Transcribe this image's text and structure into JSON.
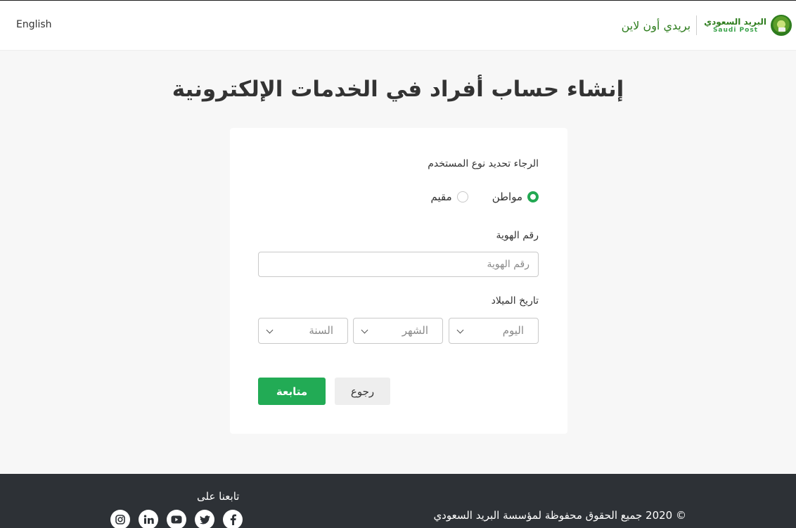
{
  "header": {
    "language_link": "English",
    "brand_arabic": "البريد السعودي",
    "brand_english": "Saudi Post",
    "service_name": "بريدي أون لاين",
    "logo_icon": "saudi-post-emblem"
  },
  "page_title": "إنشاء حساب أفراد في الخدمات الإلكترونية",
  "form": {
    "user_type_label": "الرجاء تحديد نوع المستخدم",
    "user_types": [
      {
        "label": "مواطن",
        "checked": true
      },
      {
        "label": "مقيم",
        "checked": false
      }
    ],
    "id_label": "رقم الهوية",
    "id_value": "",
    "id_placeholder": "رقم الهوية",
    "dob_label": "تاريخ الميلاد",
    "dob_selects": {
      "day": "اليوم",
      "month": "الشهر",
      "year": "السنة"
    },
    "continue_button": "متابعة",
    "back_button": "رجوع"
  },
  "footer": {
    "follow_us": "تابعنا على",
    "social_icons": [
      "facebook-icon",
      "twitter-icon",
      "youtube-icon",
      "linkedin-icon",
      "instagram-icon"
    ],
    "copyright": "© 2020 جميع الحقوق محفوظة لمؤسسة البريد السعودي"
  },
  "colors": {
    "accent_green": "#22ab55",
    "brand_green": "#2e7d1e",
    "footer_bg": "#2d3136",
    "page_bg": "#f7f7f7"
  }
}
